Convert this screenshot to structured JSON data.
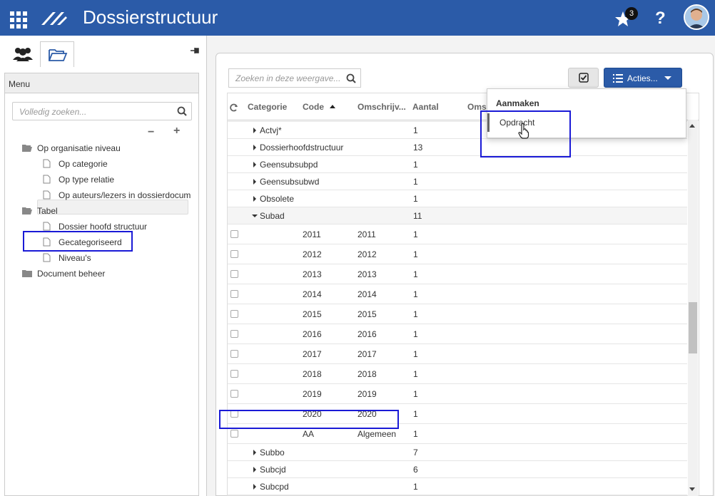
{
  "header": {
    "title": "Dossierstructuur",
    "notification_count": "3",
    "help_label": "?"
  },
  "left": {
    "menu_title": "Menu",
    "search_placeholder": "Volledig zoeken...",
    "tree": [
      {
        "label": "Op organisatie niveau",
        "type": "folder-open"
      },
      {
        "label": "Op categorie",
        "type": "doc"
      },
      {
        "label": "Op type relatie",
        "type": "doc"
      },
      {
        "label": "Op auteurs/lezers in dossierdocum",
        "type": "doc"
      },
      {
        "label": "Tabel",
        "type": "folder-open"
      },
      {
        "label": "Dossier hoofd structuur",
        "type": "doc"
      },
      {
        "label": "Gecategoriseerd",
        "type": "doc",
        "selected": true
      },
      {
        "label": "Niveau's",
        "type": "doc"
      },
      {
        "label": "Document beheer",
        "type": "folder"
      }
    ]
  },
  "right": {
    "search_placeholder": "Zoeken in deze weergave...",
    "acties_label": "Acties...",
    "columns": {
      "categorie": "Categorie",
      "code": "Code",
      "omschrijving": "Omschrijv...",
      "aantal": "Aantal",
      "oms": "Oms"
    },
    "dropdown": {
      "header": "Aanmaken",
      "item": "Opdracht"
    },
    "rows": [
      {
        "kind": "group",
        "label": "Actvj*",
        "count": "1",
        "expanded": false
      },
      {
        "kind": "group",
        "label": "Dossierhoofdstructuur",
        "count": "13",
        "expanded": false
      },
      {
        "kind": "group",
        "label": "Geensubsubpd",
        "count": "1",
        "expanded": false
      },
      {
        "kind": "group",
        "label": "Geensubsubwd",
        "count": "1",
        "expanded": false
      },
      {
        "kind": "group",
        "label": "Obsolete",
        "count": "1",
        "expanded": false
      },
      {
        "kind": "group",
        "label": "Subad",
        "count": "11",
        "expanded": true
      },
      {
        "kind": "doc",
        "code": "2011",
        "oms": "2011",
        "count": "1"
      },
      {
        "kind": "doc",
        "code": "2012",
        "oms": "2012",
        "count": "1"
      },
      {
        "kind": "doc",
        "code": "2013",
        "oms": "2013",
        "count": "1"
      },
      {
        "kind": "doc",
        "code": "2014",
        "oms": "2014",
        "count": "1"
      },
      {
        "kind": "doc",
        "code": "2015",
        "oms": "2015",
        "count": "1"
      },
      {
        "kind": "doc",
        "code": "2016",
        "oms": "2016",
        "count": "1"
      },
      {
        "kind": "doc",
        "code": "2017",
        "oms": "2017",
        "count": "1"
      },
      {
        "kind": "doc",
        "code": "2018",
        "oms": "2018",
        "count": "1"
      },
      {
        "kind": "doc",
        "code": "2019",
        "oms": "2019",
        "count": "1"
      },
      {
        "kind": "doc",
        "code": "2020",
        "oms": "2020",
        "count": "1"
      },
      {
        "kind": "doc",
        "code": "AA",
        "oms": "Algemeen",
        "count": "1"
      },
      {
        "kind": "group",
        "label": "Subbo",
        "count": "7",
        "expanded": false
      },
      {
        "kind": "group",
        "label": "Subcjd",
        "count": "6",
        "expanded": false
      },
      {
        "kind": "group",
        "label": "Subcpd",
        "count": "1",
        "expanded": false
      }
    ]
  }
}
